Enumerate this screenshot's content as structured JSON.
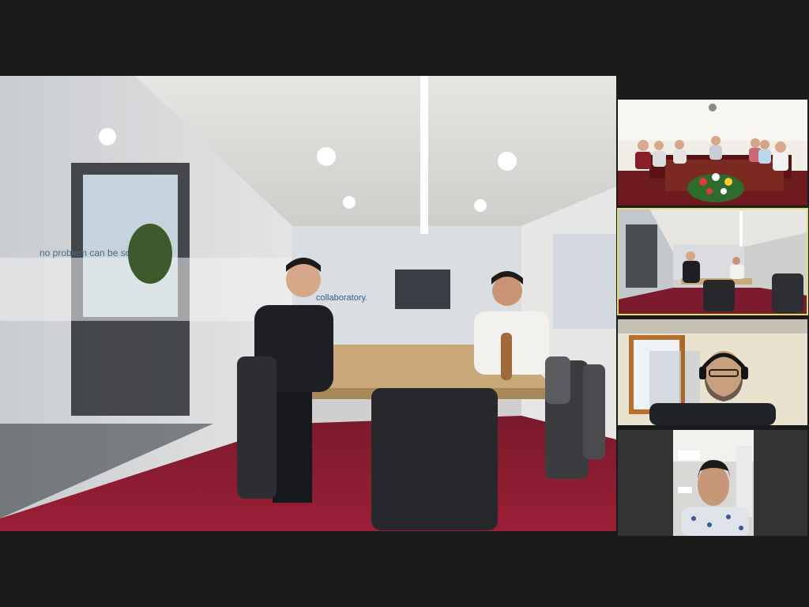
{
  "main_video": {
    "glass_text": "no problem can be so",
    "logo_text": "collaboratory."
  },
  "participants": [
    {
      "id": "tile-1",
      "active": false
    },
    {
      "id": "tile-2",
      "active": true
    },
    {
      "id": "tile-3",
      "active": false
    },
    {
      "id": "tile-4",
      "active": false
    }
  ],
  "colors": {
    "carpet": "#8a1530",
    "highlight": "#d8e06a"
  }
}
